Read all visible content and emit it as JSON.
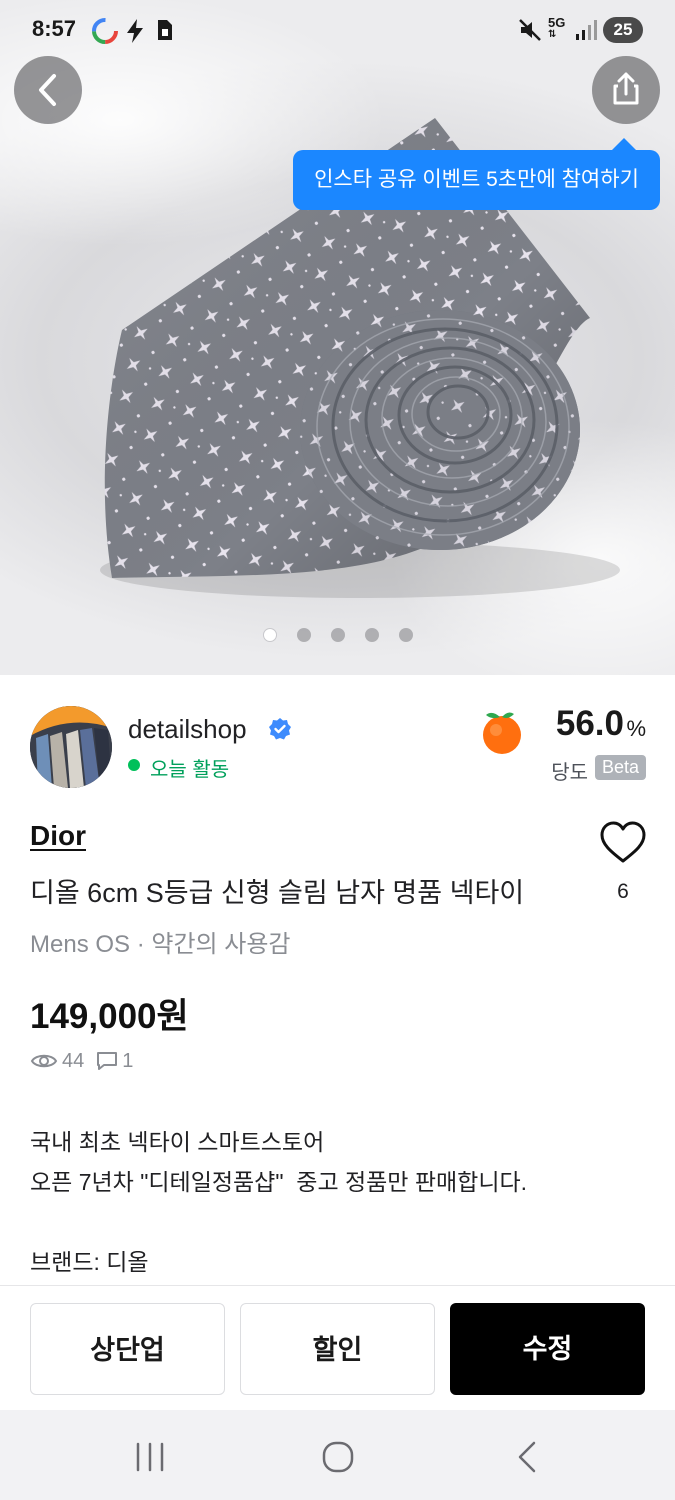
{
  "status_bar": {
    "time": "8:57",
    "network": "5G",
    "battery": "25"
  },
  "hero": {
    "tooltip": "인스타 공유 이벤트 5초만에 참여하기",
    "image_count": 5,
    "active_index": 0
  },
  "seller": {
    "name": "detailshop",
    "activity": "오늘 활동",
    "manner_temp": "56.0",
    "manner_unit": "%",
    "manner_label": "당도",
    "beta": "Beta"
  },
  "product": {
    "brand": "Dior",
    "title": "디올 6cm S등급 신형 슬림 남자 명품 넥타이",
    "meta": "Mens OS · 약간의 사용감",
    "price": "149,000원",
    "views": "44",
    "chats": "1",
    "likes": "6",
    "description": [
      "국내 최초 넥타이 스마트스토어",
      "오픈 7년차 \"디테일정품샵\"  중고 정품만 판매합니다.",
      "",
      "브랜드: 디올"
    ]
  },
  "actions": {
    "bump": "상단업",
    "discount": "할인",
    "edit": "수정"
  },
  "colors": {
    "tooltip": "#1b87ff",
    "activity": "#00a05b",
    "verified": "#3d8bfd",
    "primary_button": "#000000"
  }
}
